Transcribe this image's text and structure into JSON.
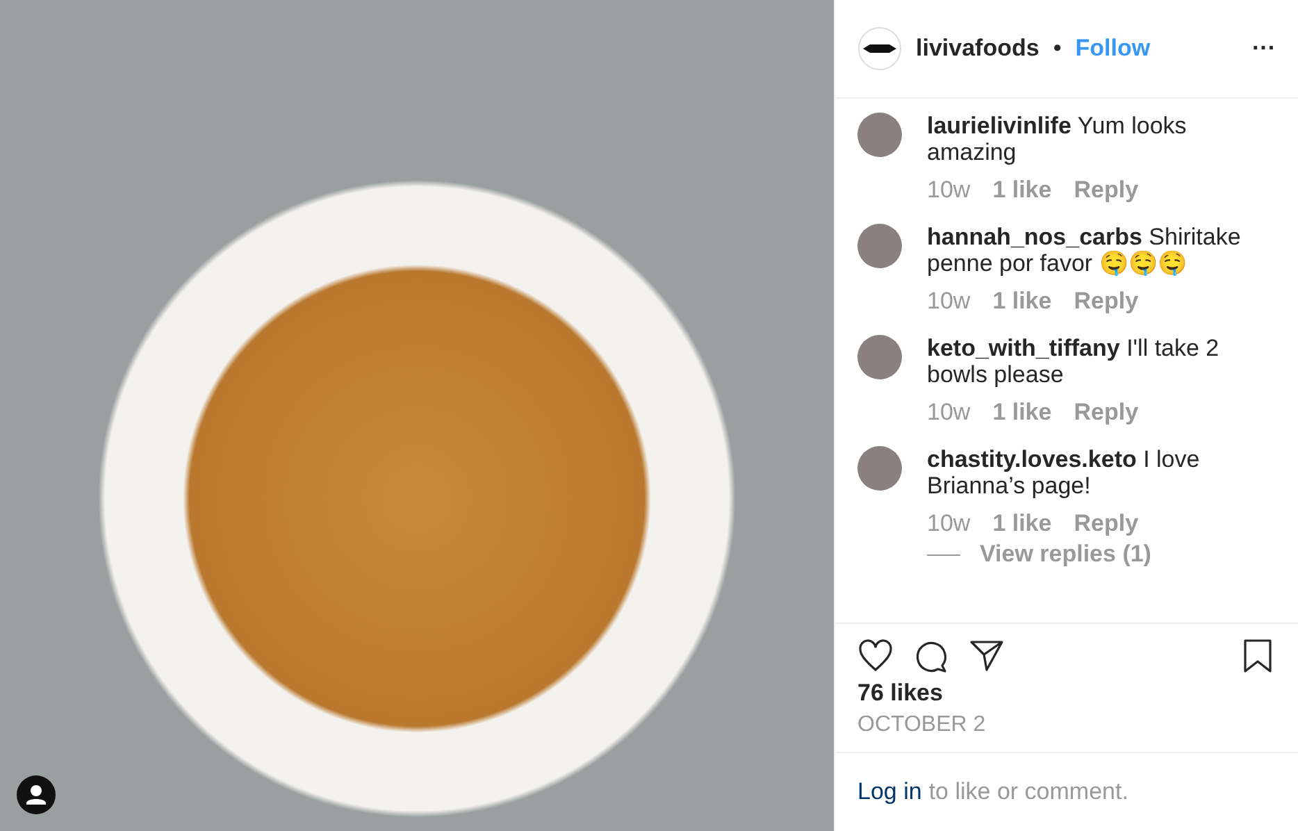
{
  "post_header": {
    "username": "livivafoods",
    "separator": "•",
    "follow": "Follow",
    "more": "···"
  },
  "comments": [
    {
      "text": "**laurielivinlife** Yum looks amazing",
      "time": "10w",
      "likes": "1 like",
      "reply": "Reply"
    },
    {
      "text": "**hannah_nos_carbs** Shiritake penne por favor 🤤🤤🤤",
      "time": "10w",
      "likes": "1 like",
      "reply": "Reply"
    },
    {
      "text": "**keto_with_tiffany** I'll take 2 bowls please",
      "time": "10w",
      "likes": "1 like",
      "reply": "Reply"
    },
    {
      "text": "**chastity.loves.keto** I love Brianna’s page!",
      "time": "10w",
      "likes": "1 like",
      "reply": "Reply",
      "view_replies": "View replies (1)"
    }
  ],
  "likes": "76 likes",
  "date": "OCTOBER 2",
  "login": {
    "link": "Log in",
    "text": "to like or comment."
  }
}
